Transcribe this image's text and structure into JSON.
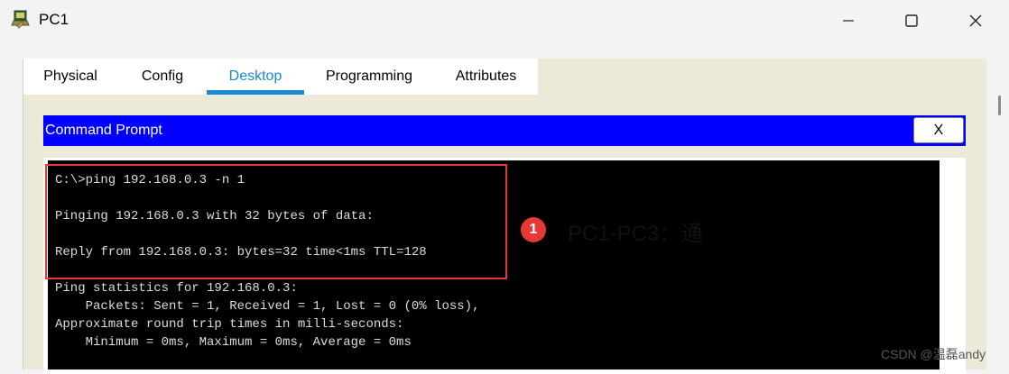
{
  "window": {
    "title": "PC1",
    "icon": "packet-tracer-pc-icon",
    "controls": [
      "minimize-icon",
      "maximize-icon",
      "close-icon"
    ]
  },
  "tabs": [
    {
      "label": "Physical"
    },
    {
      "label": "Config"
    },
    {
      "label": "Desktop",
      "active": true
    },
    {
      "label": "Programming"
    },
    {
      "label": "Attributes"
    }
  ],
  "command_prompt": {
    "title": "Command Prompt",
    "close_label": "X",
    "lines": [
      "C:\\>ping 192.168.0.3 -n 1",
      "",
      "Pinging 192.168.0.3 with 32 bytes of data:",
      "",
      "Reply from 192.168.0.3: bytes=32 time<1ms TTL=128",
      "",
      "Ping statistics for 192.168.0.3:",
      "    Packets: Sent = 1, Received = 1, Lost = 0 (0% loss),",
      "Approximate round trip times in milli-seconds:",
      "    Minimum = 0ms, Maximum = 0ms, Average = 0ms"
    ]
  },
  "annotation": {
    "number": "1",
    "text": "PC1-PC3：通"
  },
  "watermark": "CSDN @温磊andy",
  "colors": {
    "header_blue": "#0000ff",
    "active_tab": "#1a86d9",
    "highlight_red": "#e53935"
  }
}
